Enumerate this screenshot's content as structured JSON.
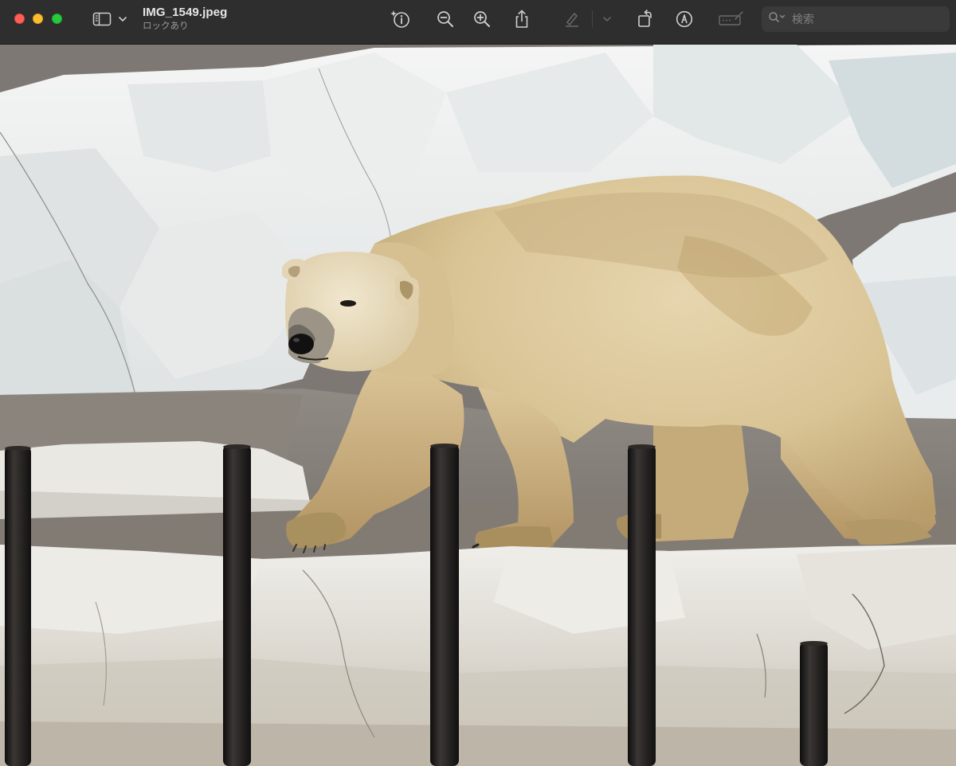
{
  "window": {
    "title": "IMG_1549.jpeg",
    "subtitle": "ロックあり"
  },
  "toolbar": {
    "buttons": [
      {
        "name": "sidebar-toggle",
        "icon": "sidebar-icon"
      },
      {
        "name": "sidebar-menu",
        "icon": "chevron-down-icon"
      },
      {
        "name": "info",
        "icon": "info-sparkle-icon"
      },
      {
        "name": "zoom-out",
        "icon": "zoom-out-icon"
      },
      {
        "name": "zoom-in",
        "icon": "zoom-in-icon"
      },
      {
        "name": "share",
        "icon": "share-icon"
      },
      {
        "name": "highlight",
        "icon": "highlighter-icon",
        "disabled": true
      },
      {
        "name": "highlight-menu",
        "icon": "chevron-down-icon",
        "disabled": true
      },
      {
        "name": "rotate",
        "icon": "rotate-icon"
      },
      {
        "name": "markup",
        "icon": "markup-pen-icon"
      },
      {
        "name": "form-fill",
        "icon": "form-fill-icon",
        "disabled": true
      }
    ]
  },
  "search": {
    "placeholder": "検索",
    "value": ""
  },
  "colors": {
    "toolbar_bg": "#2e2e2e",
    "close": "#ff5f57",
    "minimize": "#febc2e",
    "zoom": "#28c840"
  },
  "image": {
    "filename": "IMG_1549.jpeg",
    "subject": "polar bear"
  }
}
